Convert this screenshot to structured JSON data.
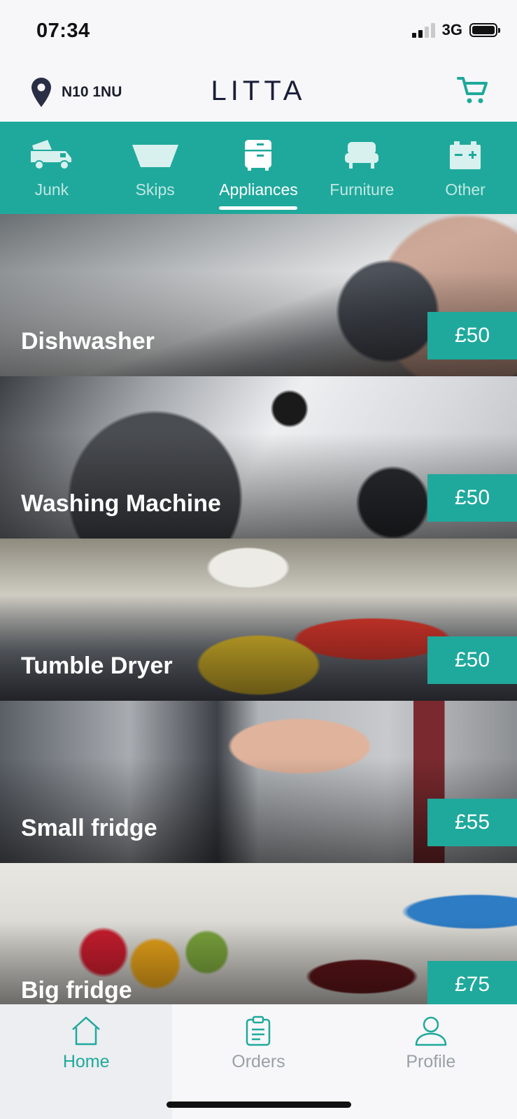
{
  "status": {
    "time": "07:34",
    "network": "3G"
  },
  "header": {
    "location": "N10 1NU",
    "brand": "LITTA"
  },
  "tabs": [
    {
      "label": "Junk",
      "icon": "truck-icon"
    },
    {
      "label": "Skips",
      "icon": "skip-icon"
    },
    {
      "label": "Appliances",
      "icon": "appliance-icon",
      "active": true
    },
    {
      "label": "Furniture",
      "icon": "sofa-icon"
    },
    {
      "label": "Other",
      "icon": "battery-icon"
    }
  ],
  "items": [
    {
      "name": "Dishwasher",
      "price": "£50"
    },
    {
      "name": "Washing Machine",
      "price": "£50"
    },
    {
      "name": "Tumble Dryer",
      "price": "£50"
    },
    {
      "name": "Small fridge",
      "price": "£55"
    },
    {
      "name": "Big fridge",
      "price": "£75"
    }
  ],
  "nav": [
    {
      "label": "Home",
      "icon": "home-icon",
      "active": true
    },
    {
      "label": "Orders",
      "icon": "clipboard-icon"
    },
    {
      "label": "Profile",
      "icon": "user-icon"
    }
  ],
  "colors": {
    "accent": "#1fa99c",
    "brand": "#1b1e3a"
  }
}
